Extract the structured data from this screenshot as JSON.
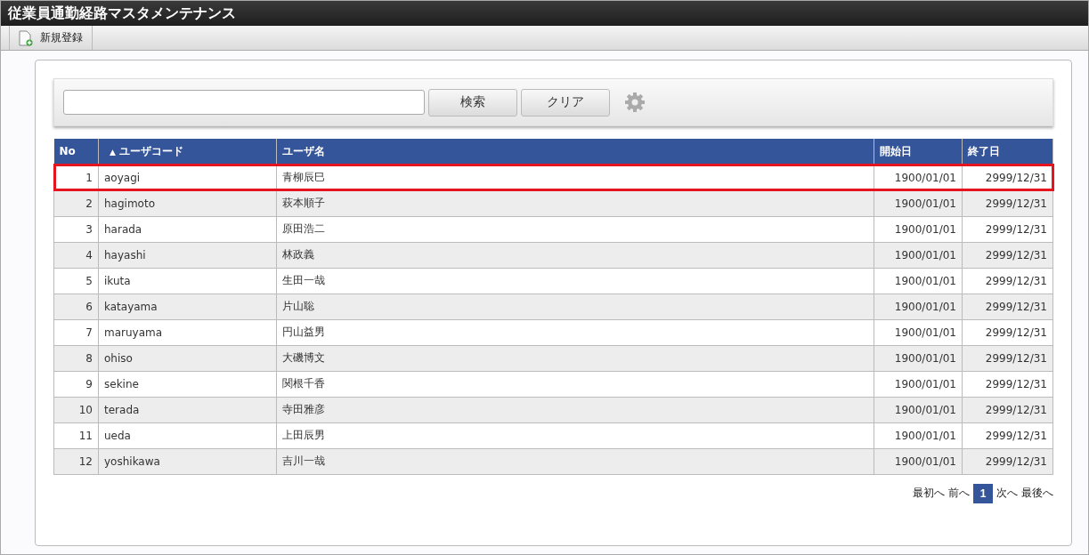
{
  "window": {
    "title": "従業員通勤経路マスタメンテナンス"
  },
  "toolbar": {
    "new_button": "新規登録"
  },
  "search": {
    "buttons": [
      "検索",
      "クリア"
    ]
  },
  "table": {
    "columns": [
      {
        "label": "No"
      },
      {
        "label": "ユーザコード",
        "sort_mark": "▲"
      },
      {
        "label": "ユーザ名"
      },
      {
        "label": "開始日"
      },
      {
        "label": "終了日"
      }
    ],
    "rows": [
      {
        "no": "1",
        "code": "aoyagi",
        "name": "青柳辰巳",
        "start": "1900/01/01",
        "end": "2999/12/31",
        "highlighted": true
      },
      {
        "no": "2",
        "code": "hagimoto",
        "name": "萩本順子",
        "start": "1900/01/01",
        "end": "2999/12/31",
        "highlighted": false
      },
      {
        "no": "3",
        "code": "harada",
        "name": "原田浩二",
        "start": "1900/01/01",
        "end": "2999/12/31",
        "highlighted": false
      },
      {
        "no": "4",
        "code": "hayashi",
        "name": "林政義",
        "start": "1900/01/01",
        "end": "2999/12/31",
        "highlighted": false
      },
      {
        "no": "5",
        "code": "ikuta",
        "name": "生田一哉",
        "start": "1900/01/01",
        "end": "2999/12/31",
        "highlighted": false
      },
      {
        "no": "6",
        "code": "katayama",
        "name": "片山聡",
        "start": "1900/01/01",
        "end": "2999/12/31",
        "highlighted": false
      },
      {
        "no": "7",
        "code": "maruyama",
        "name": "円山益男",
        "start": "1900/01/01",
        "end": "2999/12/31",
        "highlighted": false
      },
      {
        "no": "8",
        "code": "ohiso",
        "name": "大磯博文",
        "start": "1900/01/01",
        "end": "2999/12/31",
        "highlighted": false
      },
      {
        "no": "9",
        "code": "sekine",
        "name": "関根千香",
        "start": "1900/01/01",
        "end": "2999/12/31",
        "highlighted": false
      },
      {
        "no": "10",
        "code": "terada",
        "name": "寺田雅彦",
        "start": "1900/01/01",
        "end": "2999/12/31",
        "highlighted": false
      },
      {
        "no": "11",
        "code": "ueda",
        "name": "上田辰男",
        "start": "1900/01/01",
        "end": "2999/12/31",
        "highlighted": false
      },
      {
        "no": "12",
        "code": "yoshikawa",
        "name": "吉川一哉",
        "start": "1900/01/01",
        "end": "2999/12/31",
        "highlighted": false
      }
    ]
  },
  "pager": {
    "first": "最初へ",
    "prev": "前へ",
    "pages": [
      {
        "label": "1",
        "selected": true
      }
    ],
    "next": "次へ",
    "last": "最後へ"
  }
}
